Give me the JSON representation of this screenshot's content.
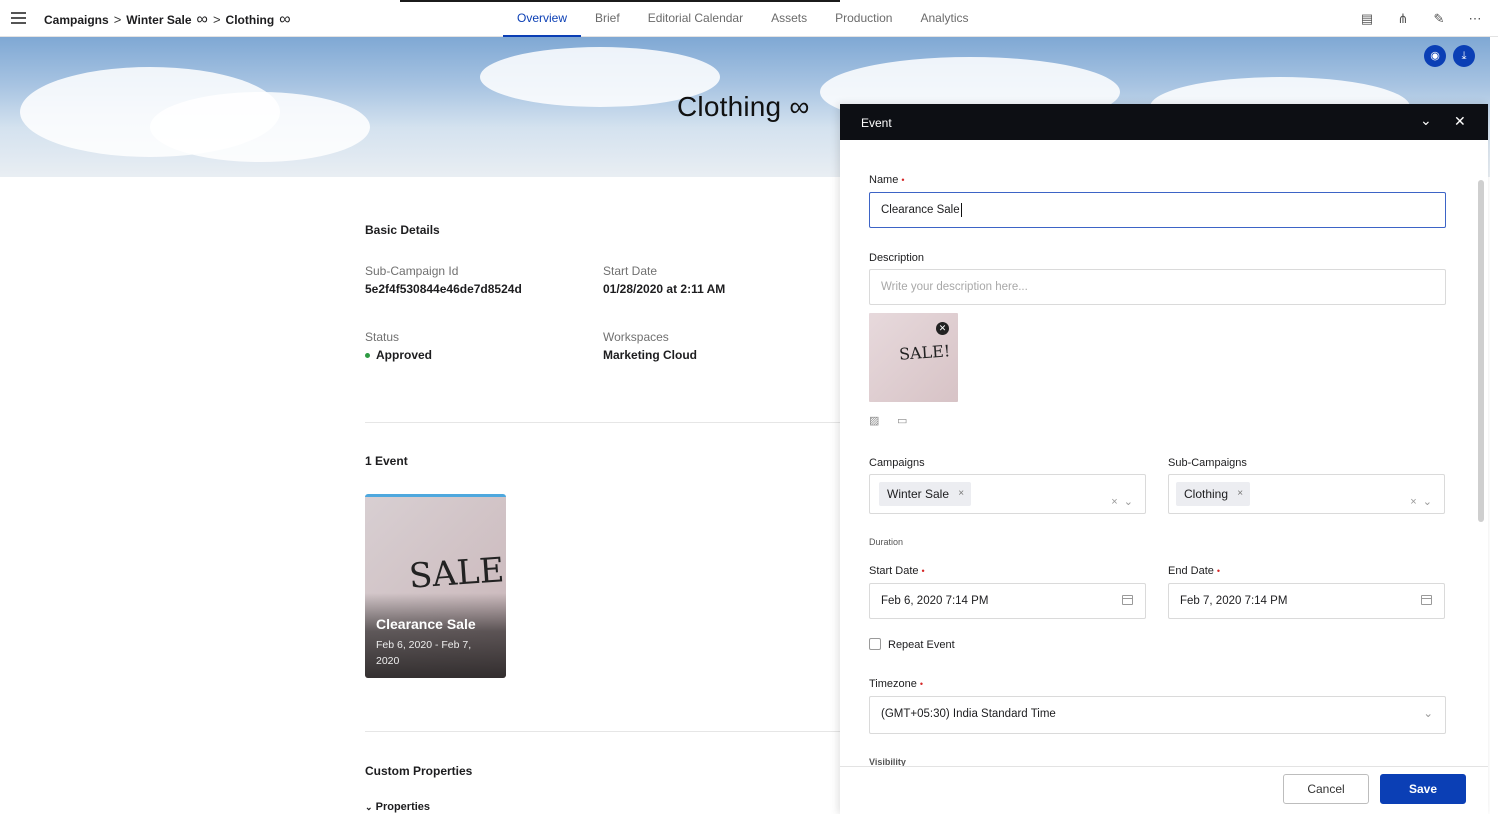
{
  "breadcrumb": {
    "items": [
      "Campaigns",
      "Winter Sale",
      "Clothing"
    ],
    "separator": ">",
    "infinity": "∞"
  },
  "tabs": [
    "Overview",
    "Brief",
    "Editorial Calendar",
    "Assets",
    "Production",
    "Analytics"
  ],
  "active_tab": "Overview",
  "toolbar_icons": [
    "document-icon",
    "hierarchy-icon",
    "edit-icon",
    "more-icon"
  ],
  "hero": {
    "title": "Clothing",
    "infinity": "∞",
    "buttons": [
      "camera-icon",
      "download-icon"
    ]
  },
  "basic_details": {
    "heading": "Basic Details",
    "sub_campaign_id_label": "Sub-Campaign Id",
    "sub_campaign_id": "5e2f4f530844e46de7d8524d",
    "start_date_label": "Start Date",
    "start_date": "01/28/2020 at 2:11 AM",
    "status_label": "Status",
    "status": "Approved",
    "workspaces_label": "Workspaces",
    "workspaces": "Marketing Cloud"
  },
  "events": {
    "heading": "1 Event",
    "card": {
      "sale_text": "SALE!",
      "title": "Clearance Sale",
      "dates": "Feb 6, 2020 - Feb 7, 2020"
    }
  },
  "custom_properties": {
    "heading": "Custom Properties",
    "toggle": "Properties"
  },
  "event_panel": {
    "title": "Event",
    "name_label": "Name",
    "name_value": "Clearance Sale",
    "description_label": "Description",
    "description_placeholder": "Write your description here...",
    "thumb_sale_text": "SALE!",
    "campaigns_label": "Campaigns",
    "campaign_chip": "Winter Sale",
    "sub_campaigns_label": "Sub-Campaigns",
    "sub_campaign_chip": "Clothing",
    "duration_label": "Duration",
    "start_date_label": "Start Date",
    "start_date_value": "Feb 6, 2020 7:14 PM",
    "end_date_label": "End Date",
    "end_date_value": "Feb 7, 2020 7:14 PM",
    "repeat_label": "Repeat Event",
    "timezone_label": "Timezone",
    "timezone_value": "(GMT+05:30) India Standard Time",
    "visibility_label": "Visibility",
    "required_mark": "•",
    "chip_remove": "×",
    "clear_icon": "×",
    "chevron": "⌄",
    "cancel_label": "Cancel",
    "save_label": "Save"
  },
  "colors": {
    "accent": "#0b3fb5",
    "status_approved": "#2e9b43",
    "panel_header": "#0d0f14"
  }
}
